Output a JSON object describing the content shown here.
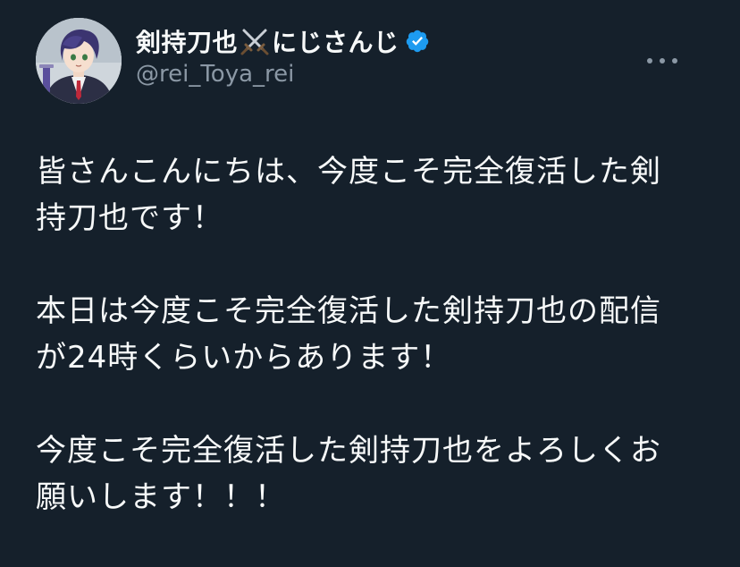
{
  "author": {
    "display_name": "剣持刀也",
    "display_name_suffix": "にじさんじ",
    "handle": "@rei_Toya_rei",
    "verified": true,
    "emoji": "crossed-swords-icon",
    "verified_color": "#1d9bf0"
  },
  "tweet": {
    "paragraphs": [
      {
        "lines": [
          "皆さんこんにちは、今度こそ完全復活した剣",
          "持刀也です！"
        ]
      },
      {
        "lines": [
          "本日は今度こそ完全復活した剣持刀也の配信",
          "が24時くらいからあります！"
        ]
      },
      {
        "lines": [
          "今度こそ完全復活した剣持刀也をよろしくお",
          "願いします！！！"
        ]
      }
    ]
  },
  "colors": {
    "background": "#15202b",
    "text": "#f7f9f9",
    "secondary_text": "#8b98a5"
  },
  "icons": {
    "more": "more-horizontal-icon",
    "avatar": "avatar"
  }
}
